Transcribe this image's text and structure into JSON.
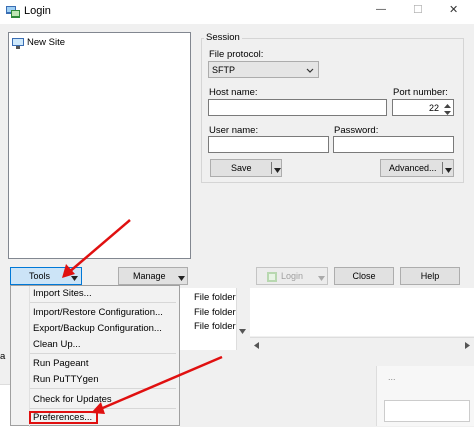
{
  "window": {
    "title": "Login",
    "minimize_glyph": "—",
    "maximize_glyph": "☐",
    "close_glyph": "✕"
  },
  "site_tree": {
    "items": [
      {
        "label": "New Site",
        "icon": "computer-icon"
      }
    ]
  },
  "session": {
    "group_label": "Session",
    "file_protocol": {
      "label": "File protocol:",
      "value": "SFTP"
    },
    "host_name": {
      "label": "Host name:",
      "value": ""
    },
    "port_number": {
      "label": "Port number:",
      "value": "22"
    },
    "user_name": {
      "label": "User name:",
      "value": ""
    },
    "password": {
      "label": "Password:",
      "value": ""
    },
    "save_label": "Save",
    "advanced_label": "Advanced..."
  },
  "bottom_buttons": {
    "tools_label": "Tools",
    "manage_label": "Manage",
    "login_label": "Login",
    "close_label": "Close",
    "help_label": "Help"
  },
  "tools_menu": {
    "items": [
      "Import Sites...",
      "Import/Restore Configuration...",
      "Export/Backup Configuration...",
      "Clean Up...",
      "Run Pageant",
      "Run PuTTYgen",
      "Check for Updates",
      "Preferences..."
    ]
  },
  "background_window": {
    "file_rows": [
      "File folder",
      "File folder",
      "File folder"
    ],
    "left_fragment": "a",
    "right_fragment": "..."
  },
  "colors": {
    "annotation_red": "#e01010",
    "selection_blue": "#cce8ff"
  }
}
